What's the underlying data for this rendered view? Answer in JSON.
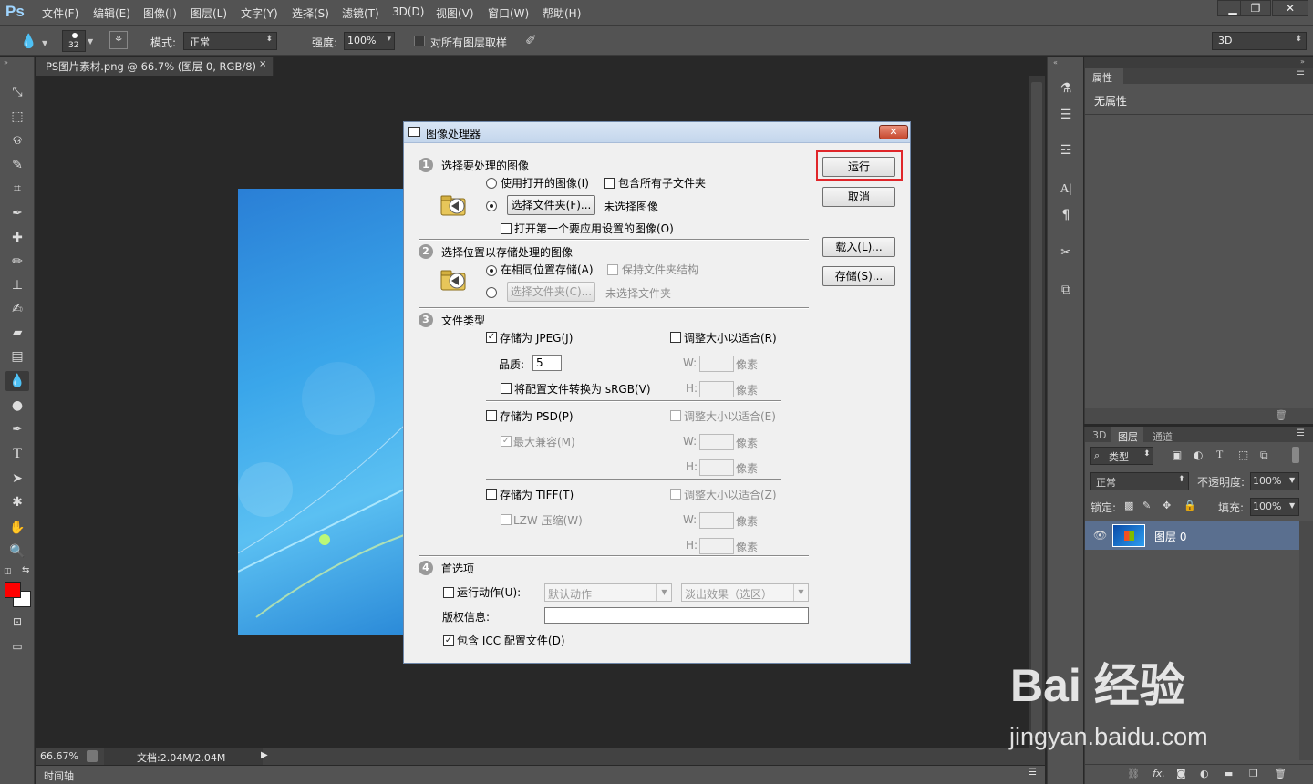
{
  "app": {
    "logo": "Ps",
    "menu": [
      "文件(F)",
      "编辑(E)",
      "图像(I)",
      "图层(L)",
      "文字(Y)",
      "选择(S)",
      "滤镜(T)",
      "3D(D)",
      "视图(V)",
      "窗口(W)",
      "帮助(H)"
    ],
    "window_buttons": [
      "▁",
      "❐",
      "✕"
    ]
  },
  "options": {
    "brush_size": "32",
    "mode_label": "模式:",
    "mode_value": "正常",
    "strength_label": "强度:",
    "strength_value": "100%",
    "sample_all_label": "对所有图层取样",
    "workspace": "3D"
  },
  "document": {
    "tab_title": "PS图片素材.png @ 66.7% (图层 0, RGB/8)",
    "zoom": "66.67%",
    "doc_size": "文档:2.04M/2.04M",
    "timeline_label": "时间轴"
  },
  "properties": {
    "tab": "属性",
    "content": "无属性"
  },
  "layers_panel": {
    "tabs": [
      "3D",
      "图层",
      "通道"
    ],
    "filter_label": "类型",
    "blend_mode": "正常",
    "opacity_label": "不透明度:",
    "opacity_value": "100%",
    "lock_label": "锁定:",
    "fill_label": "填充:",
    "fill_value": "100%",
    "layer_name": "图层 0"
  },
  "dialog": {
    "title": "图像处理器",
    "section1": {
      "num": "1",
      "title": "选择要处理的图像",
      "use_open": "使用打开的图像(I)",
      "include_sub": "包含所有子文件夹",
      "choose_folder": "选择文件夹(F)...",
      "no_image": "未选择图像",
      "open_first": "打开第一个要应用设置的图像(O)"
    },
    "section2": {
      "num": "2",
      "title": "选择位置以存储处理的图像",
      "same_location": "在相同位置存储(A)",
      "keep_structure": "保持文件夹结构",
      "choose_folder": "选择文件夹(C)...",
      "no_folder": "未选择文件夹"
    },
    "section3": {
      "num": "3",
      "title": "文件类型",
      "save_jpeg": "存储为 JPEG(J)",
      "resize_r": "调整大小以适合(R)",
      "quality_label": "品质:",
      "quality_value": "5",
      "convert_srgb": "将配置文件转换为 sRGB(V)",
      "save_psd": "存储为 PSD(P)",
      "resize_e": "调整大小以适合(E)",
      "max_compat": "最大兼容(M)",
      "save_tiff": "存储为 TIFF(T)",
      "resize_z": "调整大小以适合(Z)",
      "lzw": "LZW 压缩(W)",
      "w_label": "W:",
      "h_label": "H:",
      "px": "像素"
    },
    "section4": {
      "num": "4",
      "title": "首选项",
      "run_action": "运行动作(U):",
      "action_set": "默认动作",
      "action": "淡出效果（选区）",
      "copyright_label": "版权信息:",
      "include_icc": "包含 ICC 配置文件(D)"
    },
    "buttons": {
      "run": "运行",
      "cancel": "取消",
      "load": "载入(L)...",
      "save": "存储(S)..."
    }
  },
  "watermark": {
    "line1": "Bai 经验",
    "line2": "jingyan.baidu.com"
  },
  "colors": {
    "foreground": "#ff0000",
    "background": "#ffffff",
    "highlight": "#e0262a"
  }
}
